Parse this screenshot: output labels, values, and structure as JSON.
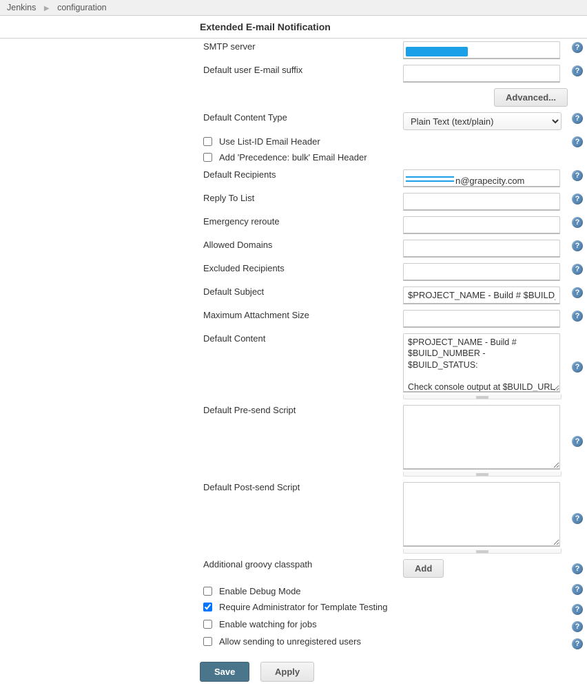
{
  "breadcrumb": {
    "root": "Jenkins",
    "page": "configuration"
  },
  "section": {
    "title": "Extended E-mail Notification"
  },
  "labels": {
    "smtp": "SMTP server",
    "suffix": "Default user E-mail suffix",
    "advanced": "Advanced...",
    "contentType": "Default Content Type",
    "useListId": "Use List-ID Email Header",
    "addPrecedence": "Add 'Precedence: bulk' Email Header",
    "defaultRecipients": "Default Recipients",
    "replyTo": "Reply To List",
    "emergency": "Emergency reroute",
    "allowed": "Allowed Domains",
    "excluded": "Excluded Recipients",
    "subject": "Default Subject",
    "maxAttach": "Maximum Attachment Size",
    "defaultContent": "Default Content",
    "preSend": "Default Pre-send Script",
    "postSend": "Default Post-send Script",
    "groovy": "Additional groovy classpath",
    "add": "Add",
    "debug": "Enable Debug Mode",
    "reqAdmin": "Require Administrator for Template Testing",
    "watching": "Enable watching for jobs",
    "allowUnreg": "Allow sending to unregistered users",
    "save": "Save",
    "apply": "Apply"
  },
  "values": {
    "contentType": "Plain Text (text/plain)",
    "recipientsSuffix": "n@grapecity.com",
    "subject": "$PROJECT_NAME - Build # $BUILD_NUMBER - $BUILD_STATUS!",
    "content": "$PROJECT_NAME - Build # $BUILD_NUMBER - $BUILD_STATUS:\n\nCheck console output at $BUILD_URL to view the results.",
    "useListId": false,
    "addPrecedence": false,
    "debug": false,
    "reqAdmin": true,
    "watching": false,
    "allowUnreg": false
  },
  "help": "?"
}
